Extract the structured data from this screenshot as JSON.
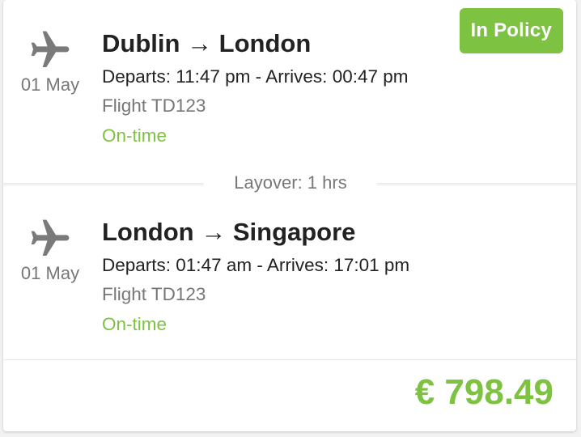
{
  "badge": {
    "label": "In Policy"
  },
  "colors": {
    "accent": "#7ec242",
    "muted": "#777777",
    "text": "#222222"
  },
  "segments": [
    {
      "icon": "airplane-icon",
      "date": "01 May",
      "route": "Dublin → London",
      "times": "Departs: 11:47 pm - Arrives: 00:47 pm",
      "flight": "Flight TD123",
      "status": "On-time"
    },
    {
      "icon": "airplane-icon",
      "date": "01 May",
      "route": "London → Singapore",
      "times": "Departs: 01:47 am - Arrives: 17:01 pm",
      "flight": "Flight TD123",
      "status": "On-time"
    }
  ],
  "layover": {
    "label": "Layover: 1 hrs"
  },
  "price": {
    "label": "€ 798.49"
  }
}
